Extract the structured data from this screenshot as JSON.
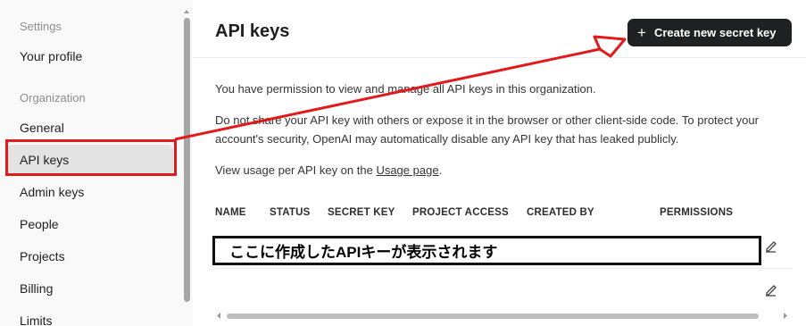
{
  "sidebar": {
    "section_settings": "Settings",
    "your_profile": "Your profile",
    "section_organization": "Organization",
    "items": {
      "general": "General",
      "api_keys": "API keys",
      "admin_keys": "Admin keys",
      "people": "People",
      "projects": "Projects",
      "billing": "Billing",
      "limits": "Limits"
    }
  },
  "header": {
    "title": "API keys",
    "create_button": "Create new secret key"
  },
  "description": {
    "permission": "You have permission to view and manage all API keys in this organization.",
    "warning": "Do not share your API key with others or expose it in the browser or other client-side code. To protect your account's security, OpenAI may automatically disable any API key that has leaked publicly.",
    "usage_prefix": "View usage per API key on the ",
    "usage_link": "Usage page",
    "usage_suffix": "."
  },
  "table": {
    "columns": [
      "NAME",
      "STATUS",
      "SECRET KEY",
      "PROJECT ACCESS",
      "CREATED BY",
      "PERMISSIONS"
    ]
  },
  "annotation": {
    "note": "ここに作成したAPIキーが表示されます"
  },
  "colors": {
    "accent_button": "#202123",
    "annotation_red": "#e11b1b",
    "active_item_bg": "#e3e3e3"
  },
  "icons": [
    "plus-icon",
    "edit-icon"
  ]
}
